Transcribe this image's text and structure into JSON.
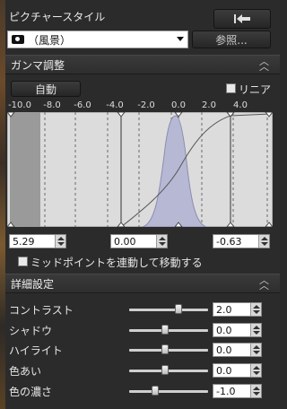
{
  "picture_style": {
    "title": "ピクチャースタイル",
    "selected_style": "（風景）",
    "browse_label": "参照...",
    "revert_icon": "revert-arrow-icon",
    "camera_icon": "camera-icon"
  },
  "gamma": {
    "title": "ガンマ調整",
    "auto_label": "自動",
    "linear_label": "リニア",
    "linear_checked": false,
    "axis_ticks": [
      "-10.0",
      "-8.0",
      "-6.0",
      "-4.0",
      "-2.0",
      "0.0",
      "2.0",
      "4.0"
    ],
    "black_point": "5.29",
    "mid_point": "0.00",
    "white_point": "-0.63",
    "midpoint_link_label": "ミッドポイントを連動して移動する",
    "midpoint_link_checked": false
  },
  "detail": {
    "title": "詳細設定",
    "rows": [
      {
        "label": "コントラスト",
        "value": "2.0",
        "slider_level": 0.62
      },
      {
        "label": "シャドウ",
        "value": "0.0",
        "slider_level": 0.45
      },
      {
        "label": "ハイライト",
        "value": "0.0",
        "slider_level": 0.45
      },
      {
        "label": "色あい",
        "value": "0.0",
        "slider_level": 0.45
      },
      {
        "label": "色の濃さ",
        "value": "-1.0",
        "slider_level": 0.33
      }
    ]
  },
  "colors": {
    "histogram": "#b7b8d4",
    "graph_bg": "#dcdcdc",
    "dark_band": "#9a9a9a"
  }
}
